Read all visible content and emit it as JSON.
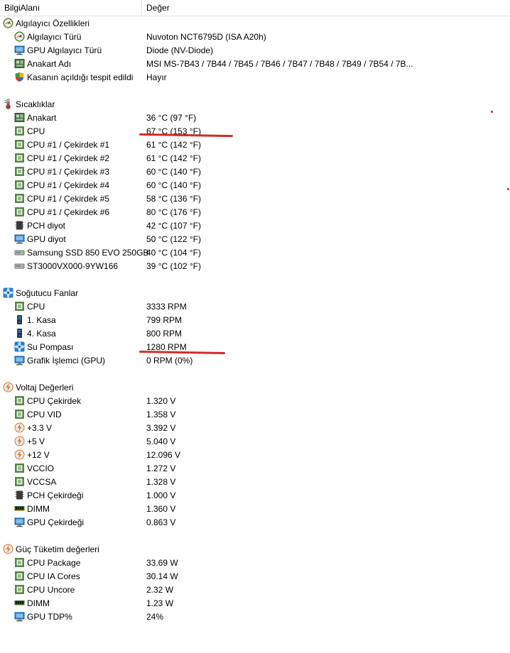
{
  "columns": {
    "field": "BilgiAlanı",
    "value": "Değer"
  },
  "rows": [
    {
      "kind": "group",
      "icon": "sensor",
      "label": "Algılayıcı Özellikleri"
    },
    {
      "kind": "item",
      "icon": "sensor",
      "label": "Algılayıcı Türü",
      "value": "Nuvoton NCT6795D  (ISA A20h)"
    },
    {
      "kind": "item",
      "icon": "gpu",
      "label": "GPU Algılayıcı Türü",
      "value": "Diode  (NV-Diode)"
    },
    {
      "kind": "item",
      "icon": "board",
      "label": "Anakart Adı",
      "value": "MSI MS-7B43 / 7B44 / 7B45 / 7B46 / 7B47 / 7B48 / 7B49 / 7B54 / 7B..."
    },
    {
      "kind": "item",
      "icon": "shield",
      "label": "Kasanın açıldığı tespit edildi",
      "value": "Hayır"
    },
    {
      "kind": "spacer"
    },
    {
      "kind": "group",
      "icon": "thermo",
      "label": "Sıcaklıklar"
    },
    {
      "kind": "item",
      "icon": "board",
      "label": "Anakart",
      "value": "36 °C  (97 °F)"
    },
    {
      "kind": "item",
      "icon": "chip",
      "label": "CPU",
      "value": "67 °C  (153 °F)"
    },
    {
      "kind": "item",
      "icon": "chip",
      "label": "CPU #1 / Çekirdek #1",
      "value": "61 °C  (142 °F)"
    },
    {
      "kind": "item",
      "icon": "chip",
      "label": "CPU #1 / Çekirdek #2",
      "value": "61 °C  (142 °F)"
    },
    {
      "kind": "item",
      "icon": "chip",
      "label": "CPU #1 / Çekirdek #3",
      "value": "60 °C  (140 °F)"
    },
    {
      "kind": "item",
      "icon": "chip",
      "label": "CPU #1 / Çekirdek #4",
      "value": "60 °C  (140 °F)"
    },
    {
      "kind": "item",
      "icon": "chip",
      "label": "CPU #1 / Çekirdek #5",
      "value": "58 °C  (136 °F)"
    },
    {
      "kind": "item",
      "icon": "chip",
      "label": "CPU #1 / Çekirdek #6",
      "value": "80 °C  (176 °F)"
    },
    {
      "kind": "item",
      "icon": "pch",
      "label": "PCH diyot",
      "value": "42 °C  (107 °F)"
    },
    {
      "kind": "item",
      "icon": "gpu",
      "label": "GPU diyot",
      "value": "50 °C  (122 °F)"
    },
    {
      "kind": "item",
      "icon": "drive",
      "label": "Samsung SSD 850 EVO 250GB",
      "value": "40 °C  (104 °F)"
    },
    {
      "kind": "item",
      "icon": "drive",
      "label": "ST3000VX000-9YW166",
      "value": "39 °C  (102 °F)"
    },
    {
      "kind": "spacer"
    },
    {
      "kind": "group",
      "icon": "fan",
      "label": "Soğutucu Fanlar"
    },
    {
      "kind": "item",
      "icon": "chip",
      "label": "CPU",
      "value": "3333 RPM"
    },
    {
      "kind": "item",
      "icon": "case",
      "label": "1. Kasa",
      "value": "799 RPM"
    },
    {
      "kind": "item",
      "icon": "case",
      "label": "4. Kasa",
      "value": "800 RPM"
    },
    {
      "kind": "item",
      "icon": "fan",
      "label": "Su Pompası",
      "value": "1280 RPM"
    },
    {
      "kind": "item",
      "icon": "gpu",
      "label": "Grafik İşlemci (GPU)",
      "value": "0 RPM  (0%)"
    },
    {
      "kind": "spacer"
    },
    {
      "kind": "group",
      "icon": "bolt",
      "label": "Voltaj Değerleri"
    },
    {
      "kind": "item",
      "icon": "chip",
      "label": "CPU Çekirdek",
      "value": "1.320 V"
    },
    {
      "kind": "item",
      "icon": "chip",
      "label": "CPU VID",
      "value": "1.358 V"
    },
    {
      "kind": "item",
      "icon": "bolt",
      "label": "+3.3 V",
      "value": "3.392 V"
    },
    {
      "kind": "item",
      "icon": "bolt",
      "label": "+5 V",
      "value": "5.040 V"
    },
    {
      "kind": "item",
      "icon": "bolt",
      "label": "+12 V",
      "value": "12.096 V"
    },
    {
      "kind": "item",
      "icon": "chip",
      "label": "VCCIO",
      "value": "1.272 V"
    },
    {
      "kind": "item",
      "icon": "chip",
      "label": "VCCSA",
      "value": "1.328 V"
    },
    {
      "kind": "item",
      "icon": "pch",
      "label": "PCH Çekirdeği",
      "value": "1.000 V"
    },
    {
      "kind": "item",
      "icon": "dimm",
      "label": "DIMM",
      "value": "1.360 V"
    },
    {
      "kind": "item",
      "icon": "gpu",
      "label": "GPU Çekirdeği",
      "value": "0.863 V"
    },
    {
      "kind": "spacer"
    },
    {
      "kind": "group",
      "icon": "bolt",
      "label": "Güç Tüketim değerleri"
    },
    {
      "kind": "item",
      "icon": "chip",
      "label": "CPU Package",
      "value": "33.69 W"
    },
    {
      "kind": "item",
      "icon": "chip",
      "label": "CPU IA Cores",
      "value": "30.14 W"
    },
    {
      "kind": "item",
      "icon": "chip",
      "label": "CPU Uncore",
      "value": "2.32 W"
    },
    {
      "kind": "item",
      "icon": "dimm",
      "label": "DIMM",
      "value": "1.23 W"
    },
    {
      "kind": "item",
      "icon": "gpu",
      "label": "GPU TDP%",
      "value": "24%"
    }
  ],
  "annotation_color": "#d42b2b"
}
